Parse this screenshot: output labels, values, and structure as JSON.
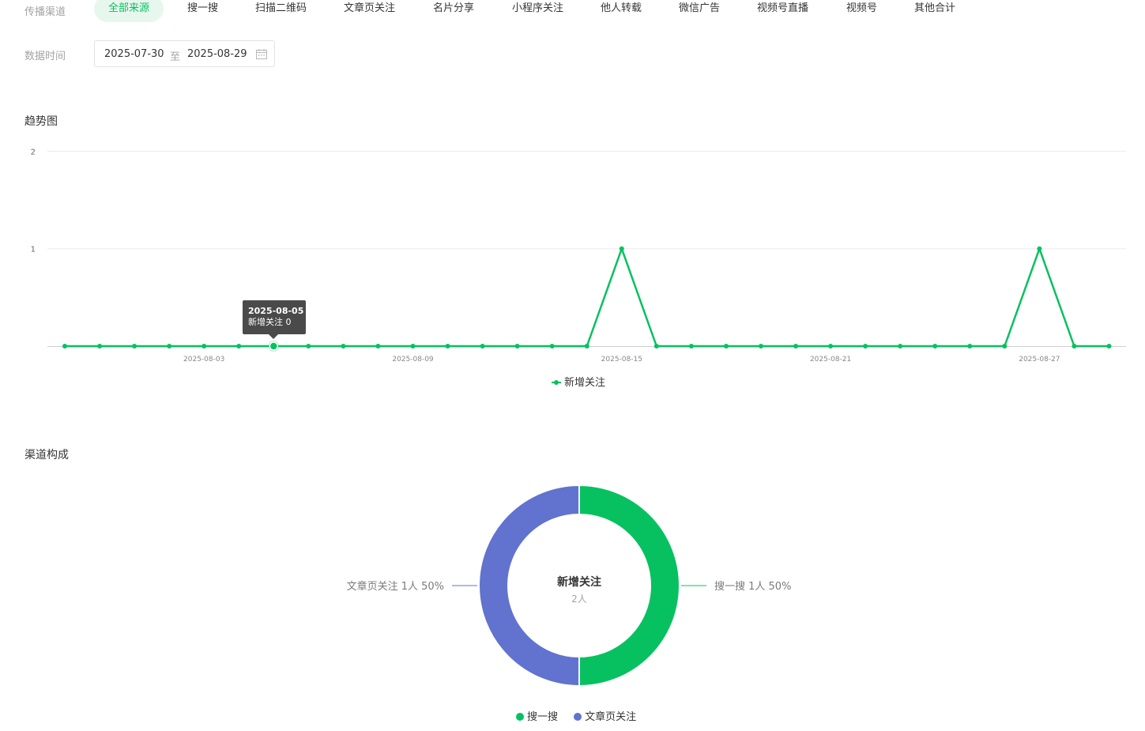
{
  "filters": {
    "channel_label": "传播渠道",
    "channels": [
      "全部来源",
      "搜一搜",
      "扫描二维码",
      "文章页关注",
      "名片分享",
      "小程序关注",
      "他人转载",
      "微信广告",
      "视频号直播",
      "视频号",
      "其他合计"
    ],
    "active_channel": "全部来源",
    "date_label": "数据时间",
    "date_start": "2025-07-30",
    "date_sep": "至",
    "date_end": "2025-08-29"
  },
  "trend": {
    "title": "趋势图",
    "tooltip": {
      "date": "2025-08-05",
      "text": "新增关注 0"
    },
    "legend": "新增关注"
  },
  "composition": {
    "title": "渠道构成",
    "center_title": "新增关注",
    "center_value": "2人",
    "legend": [
      "搜一搜",
      "文章页关注"
    ]
  },
  "colors": {
    "accent": "#07c160",
    "series2": "#6173ce",
    "active_tab_bg": "#e8f7ee"
  },
  "chart_data": [
    {
      "type": "line",
      "x": [
        "2025-07-30",
        "2025-07-31",
        "2025-08-01",
        "2025-08-02",
        "2025-08-03",
        "2025-08-04",
        "2025-08-05",
        "2025-08-06",
        "2025-08-07",
        "2025-08-08",
        "2025-08-09",
        "2025-08-10",
        "2025-08-11",
        "2025-08-12",
        "2025-08-13",
        "2025-08-14",
        "2025-08-15",
        "2025-08-16",
        "2025-08-17",
        "2025-08-18",
        "2025-08-19",
        "2025-08-20",
        "2025-08-21",
        "2025-08-22",
        "2025-08-23",
        "2025-08-24",
        "2025-08-25",
        "2025-08-26",
        "2025-08-27",
        "2025-08-28",
        "2025-08-29"
      ],
      "series": [
        {
          "name": "新增关注",
          "values": [
            0,
            0,
            0,
            0,
            0,
            0,
            0,
            0,
            0,
            0,
            0,
            0,
            0,
            0,
            0,
            0,
            1,
            0,
            0,
            0,
            0,
            0,
            0,
            0,
            0,
            0,
            0,
            0,
            1,
            0,
            0
          ]
        }
      ],
      "xticks": [
        "2025-08-03",
        "2025-08-09",
        "2025-08-15",
        "2025-08-21",
        "2025-08-27"
      ],
      "yticks": [
        1,
        2
      ],
      "ylim": [
        0,
        2
      ],
      "grid": true,
      "legend_position": "bottom"
    },
    {
      "type": "pie",
      "slices": [
        {
          "name": "搜一搜",
          "value": 1,
          "unit": "人",
          "percent": 50,
          "label": "搜一搜 1人 50%",
          "color": "#07c160"
        },
        {
          "name": "文章页关注",
          "value": 1,
          "unit": "人",
          "percent": 50,
          "label": "文章页关注 1人 50%",
          "color": "#6173ce"
        }
      ],
      "legend_position": "bottom"
    }
  ]
}
